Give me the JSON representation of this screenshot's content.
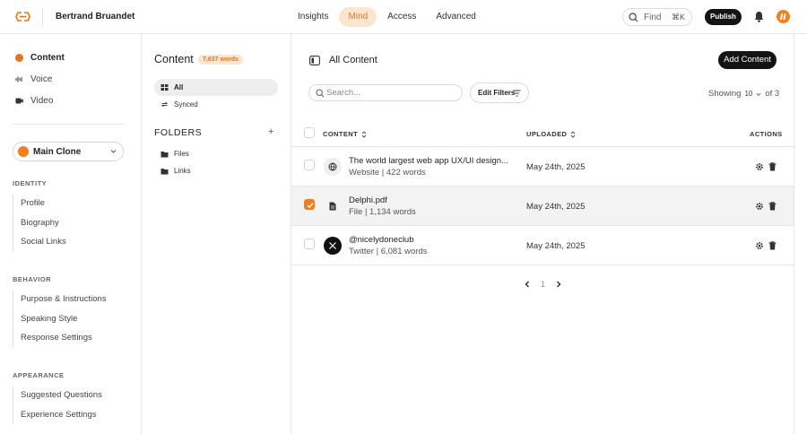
{
  "topbar": {
    "user_name": "Bertrand Bruandet",
    "nav": [
      {
        "label": "Insights",
        "active": false
      },
      {
        "label": "Mind",
        "active": true
      },
      {
        "label": "Access",
        "active": false
      },
      {
        "label": "Advanced",
        "active": false
      }
    ],
    "find_label": "Find",
    "find_shortcut": "⌘K",
    "publish_label": "Publish",
    "accent_color": "#e8731a"
  },
  "sidebar": {
    "items": [
      {
        "label": "Content",
        "icon": "dot-icon",
        "active": true
      },
      {
        "label": "Voice",
        "icon": "waveform-icon",
        "active": false
      },
      {
        "label": "Video",
        "icon": "video-icon",
        "active": false
      }
    ],
    "clone_label": "Main Clone",
    "sections": [
      {
        "title": "IDENTITY",
        "items": [
          "Profile",
          "Biography",
          "Social Links"
        ]
      },
      {
        "title": "BEHAVIOR",
        "items": [
          "Purpose & Instructions",
          "Speaking Style",
          "Response Settings"
        ]
      },
      {
        "title": "APPEARANCE",
        "items": [
          "Suggested Questions",
          "Experience Settings"
        ]
      }
    ]
  },
  "content_panel": {
    "title": "Content",
    "word_badge": "7,637 words",
    "filters": [
      {
        "label": "All",
        "active": true
      },
      {
        "label": "Synced",
        "active": false
      }
    ],
    "folders_title": "FOLDERS",
    "folders": [
      "Files",
      "Links"
    ]
  },
  "main": {
    "title": "All Content",
    "add_label": "Add Content",
    "search_placeholder": "Search...",
    "edit_filters_label": "Edit Filters",
    "showing_label": "Showing",
    "showing_count": "10",
    "showing_of": "of 3",
    "columns": {
      "content": "CONTENT",
      "uploaded": "UPLOADED",
      "actions": "ACTIONS"
    },
    "rows": [
      {
        "title": "The world largest web app UX/UI design...",
        "subtitle": "Website | 422 words",
        "date": "May 24th, 2025",
        "icon": "globe-icon",
        "selected": false
      },
      {
        "title": "Delphi.pdf",
        "subtitle": "File | 1,134 words",
        "date": "May 24th, 2025",
        "icon": "file-icon",
        "selected": true
      },
      {
        "title": "@nicelydoneclub",
        "subtitle": "Twitter | 6,081 words",
        "date": "May 24th, 2025",
        "icon": "x-logo-icon",
        "selected": false
      }
    ],
    "pagination": {
      "current_page": "1"
    }
  }
}
